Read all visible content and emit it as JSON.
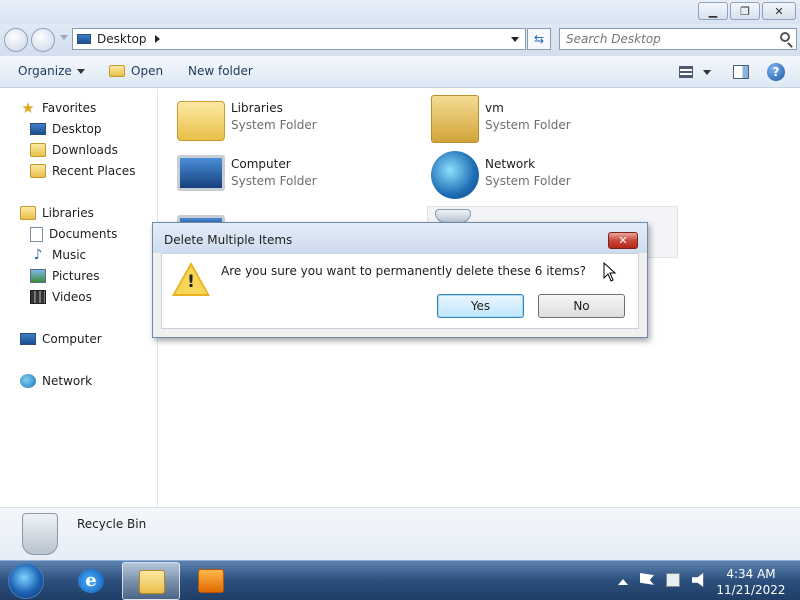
{
  "window": {
    "address_crumb": "Desktop",
    "search_placeholder": "Search Desktop"
  },
  "toolbar": {
    "organize_label": "Organize",
    "open_label": "Open",
    "new_folder_label": "New folder"
  },
  "nav": {
    "favorites": "Favorites",
    "desktop": "Desktop",
    "downloads": "Downloads",
    "recent_places": "Recent Places",
    "libraries": "Libraries",
    "documents": "Documents",
    "music": "Music",
    "pictures": "Pictures",
    "videos": "Videos",
    "computer": "Computer",
    "network": "Network"
  },
  "items": [
    {
      "name": "Libraries",
      "type": "System Folder"
    },
    {
      "name": "vm",
      "type": "System Folder"
    },
    {
      "name": "Computer",
      "type": "System Folder"
    },
    {
      "name": "Network",
      "type": "System Folder"
    }
  ],
  "details": {
    "selected_name": "Recycle Bin"
  },
  "dialog": {
    "title": "Delete Multiple Items",
    "message": "Are you sure you want to permanently delete these 6 items?",
    "yes_label": "Yes",
    "no_label": "No",
    "close_glyph": "✕"
  },
  "taskbar": {
    "time": "4:34 AM",
    "date": "11/21/2022",
    "ie_glyph": "e"
  },
  "icons": {
    "help_glyph": "?",
    "refresh_glyph": "⇆",
    "warning_glyph": "!"
  }
}
